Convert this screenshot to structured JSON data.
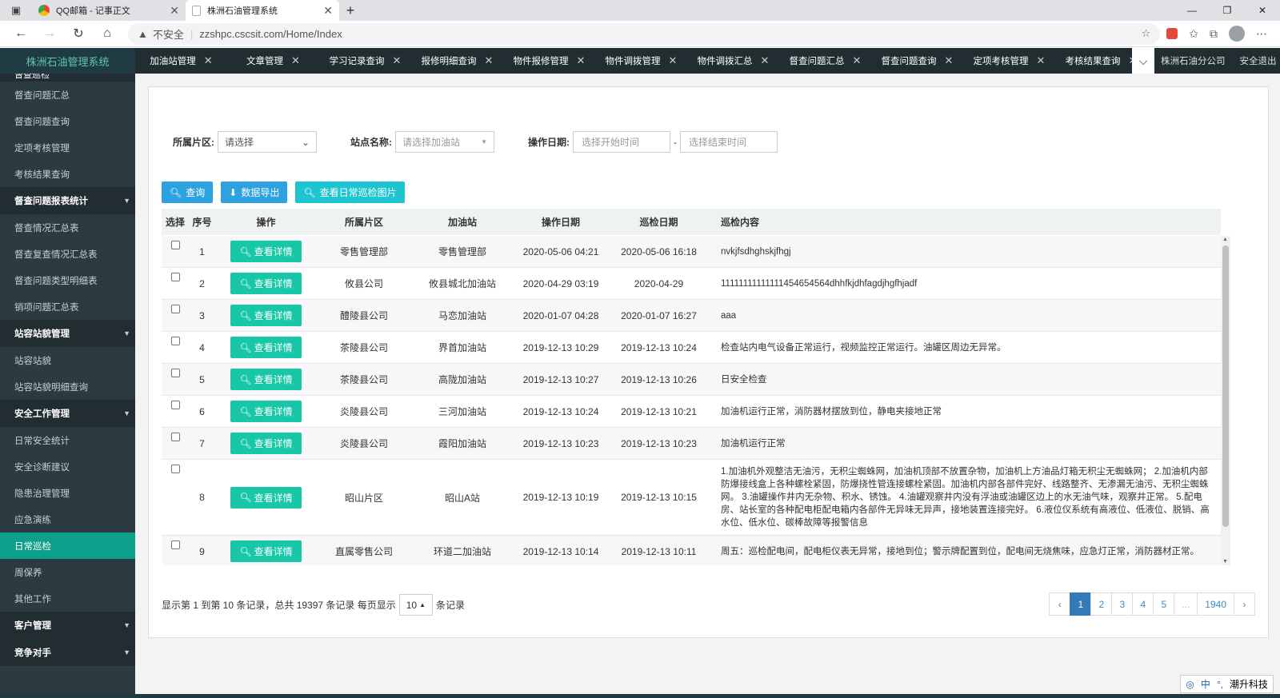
{
  "browser": {
    "tabs": [
      {
        "title": "QQ邮箱 - 记事正文",
        "active": false
      },
      {
        "title": "株洲石油管理系统",
        "active": true
      }
    ],
    "url_warning": "不安全",
    "url": "zzshpc.cscsit.com/Home/Index"
  },
  "app": {
    "brand": "株洲石油管理系统",
    "top_tabs": [
      "加油站管理",
      "文章管理",
      "学习记录查询",
      "报修明细查询",
      "物件报修管理",
      "物件调拨管理",
      "物件调拨汇总",
      "督查问题汇总",
      "督查问题查询",
      "定项考核管理",
      "考核结果查询"
    ],
    "org": "株洲石油分公司",
    "logout": "安全退出"
  },
  "sidebar": {
    "cut_top": "督查巡检",
    "sections": [
      {
        "type": "item",
        "label": "督查问题汇总"
      },
      {
        "type": "item",
        "label": "督查问题查询"
      },
      {
        "type": "item",
        "label": "定项考核管理"
      },
      {
        "type": "item",
        "label": "考核结果查询"
      },
      {
        "type": "group",
        "label": "督查问题报表统计"
      },
      {
        "type": "item",
        "label": "督查情况汇总表"
      },
      {
        "type": "item",
        "label": "督查复查情况汇总表"
      },
      {
        "type": "item",
        "label": "督查问题类型明细表"
      },
      {
        "type": "item",
        "label": "销项问题汇总表"
      },
      {
        "type": "group",
        "label": "站容站貌管理"
      },
      {
        "type": "item",
        "label": "站容站貌"
      },
      {
        "type": "item",
        "label": "站容站貌明细查询"
      },
      {
        "type": "group",
        "label": "安全工作管理"
      },
      {
        "type": "item",
        "label": "日常安全统计"
      },
      {
        "type": "item",
        "label": "安全诊断建议"
      },
      {
        "type": "item",
        "label": "隐患治理管理"
      },
      {
        "type": "item",
        "label": "应急演练"
      },
      {
        "type": "item",
        "label": "日常巡检",
        "active": true
      },
      {
        "type": "item",
        "label": "周保养"
      },
      {
        "type": "item",
        "label": "其他工作"
      },
      {
        "type": "group",
        "label": "客户管理"
      },
      {
        "type": "group",
        "label": "竞争对手"
      }
    ]
  },
  "filters": {
    "area_label": "所属片区:",
    "area_value": "请选择",
    "station_label": "站点名称:",
    "station_placeholder": "请选择加油站",
    "date_label": "操作日期:",
    "start_placeholder": "选择开始时间",
    "dash": "-",
    "end_placeholder": "选择结束时间"
  },
  "buttons": {
    "query": "查询",
    "export": "数据导出",
    "images": "查看日常巡检图片"
  },
  "table": {
    "headers": [
      "选择",
      "序号",
      "操作",
      "所属片区",
      "加油站",
      "操作日期",
      "巡检日期",
      "巡检内容"
    ],
    "detail_label": "查看详情",
    "rows": [
      {
        "no": "1",
        "area": "零售管理部",
        "station": "零售管理部",
        "op_date": "2020-05-06 04:21",
        "check_date": "2020-05-06 16:18",
        "content": "nvkjfsdhghskjfhgj"
      },
      {
        "no": "2",
        "area": "攸县公司",
        "station": "攸县城北加油站",
        "op_date": "2020-04-29 03:19",
        "check_date": "2020-04-29",
        "content": "11111111111111454654564dhhfkjdhfagdjhgfhjadf"
      },
      {
        "no": "3",
        "area": "醴陵县公司",
        "station": "马恋加油站",
        "op_date": "2020-01-07 04:28",
        "check_date": "2020-01-07 16:27",
        "content": "aaa"
      },
      {
        "no": "4",
        "area": "茶陵县公司",
        "station": "界首加油站",
        "op_date": "2019-12-13 10:29",
        "check_date": "2019-12-13 10:24",
        "content": "检查站内电气设备正常运行，视频监控正常运行。油罐区周边无异常。"
      },
      {
        "no": "5",
        "area": "茶陵县公司",
        "station": "高陇加油站",
        "op_date": "2019-12-13 10:27",
        "check_date": "2019-12-13 10:26",
        "content": "日安全检查"
      },
      {
        "no": "6",
        "area": "炎陵县公司",
        "station": "三河加油站",
        "op_date": "2019-12-13 10:24",
        "check_date": "2019-12-13 10:21",
        "content": "加油机运行正常，消防器材摆放到位，静电夹接地正常"
      },
      {
        "no": "7",
        "area": "炎陵县公司",
        "station": "霞阳加油站",
        "op_date": "2019-12-13 10:23",
        "check_date": "2019-12-13 10:23",
        "content": "加油机运行正常"
      },
      {
        "no": "8",
        "area": "昭山片区",
        "station": "昭山A站",
        "op_date": "2019-12-13 10:19",
        "check_date": "2019-12-13 10:15",
        "content": "1.加油机外观整洁无油污，无积尘蜘蛛网，加油机顶部不放置杂物，加油机上方油品灯箱无积尘无蜘蛛网； 2.加油机内部防爆接线盒上各种螺栓紧固，防爆挠性管连接螺栓紧固。加油机内部各部件完好、线路整齐、无渗漏无油污、无积尘蜘蛛网。 3.油罐操作井内无杂物、积水、锈蚀。 4.油罐观察井内没有浮油或油罐区边上的水无油气味，观察井正常。 5.配电房、站长室的各种配电柜配电箱内各部件无异味无异声，接地装置连接完好。 6.液位仪系统有高液位、低液位、脱销、高水位、低水位、碳棒故障等报警信息",
        "tall": true
      },
      {
        "no": "9",
        "area": "直属零售公司",
        "station": "环道二加油站",
        "op_date": "2019-12-13 10:14",
        "check_date": "2019-12-13 10:11",
        "content": "周五：巡检配电间，配电柜仪表无异常，接地到位；警示牌配置到位，配电间无烧焦味，应急灯正常，消防器材正常。"
      },
      {
        "no": "",
        "area": "",
        "station": "",
        "op_date": "",
        "check_date": "",
        "content": "1.加油机外观整洁无油污，无积尘蜘蛛网，加油机顶部不放置杂物，加油机上方油品灯箱无积尘无蜘蛛网； 2.加油机内部防"
      }
    ]
  },
  "pagination": {
    "info_prefix": "显示第 1 到第 10 条记录，总共 19397 条记录 每页显示",
    "page_size": "10",
    "info_suffix": "条记录",
    "pages": [
      "‹",
      "1",
      "2",
      "3",
      "4",
      "5",
      "...",
      "1940",
      "›"
    ],
    "active_page": "1"
  },
  "tray": {
    "ime": "中",
    "label": "潮升科技"
  }
}
